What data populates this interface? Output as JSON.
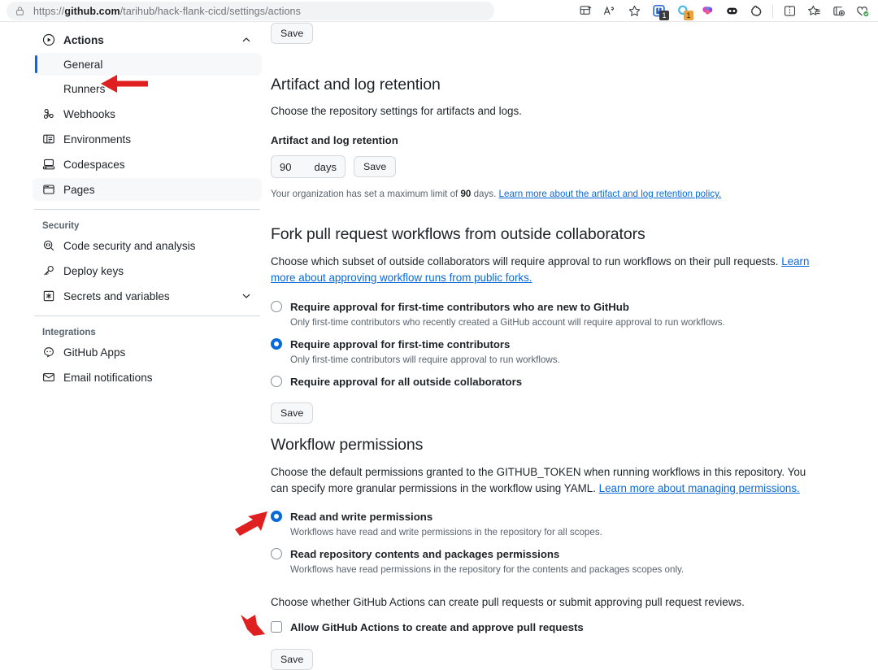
{
  "browser": {
    "url_prefix": "https://",
    "url_domain": "github.com",
    "url_path": "/tarihub/hack-flank-cicd/settings/actions",
    "url_full": "https://github.com/tarihub/hack-flank-cicd/settings/actions",
    "toolbar_icons": [
      {
        "name": "collections-icon",
        "badge": ""
      },
      {
        "name": "read-aloud-icon",
        "badge": ""
      },
      {
        "name": "favorite-star-icon",
        "badge": ""
      },
      {
        "name": "extension-blue-icon",
        "badge": "1"
      },
      {
        "name": "extension-cyan-icon",
        "badge": "1"
      },
      {
        "name": "extension-brain-icon",
        "badge": ""
      },
      {
        "name": "extension-dark-icon",
        "badge": ""
      },
      {
        "name": "extension-puzzle-icon",
        "badge": ""
      },
      {
        "name": "split-screen-icon",
        "badge": ""
      },
      {
        "name": "favorites-list-icon",
        "badge": ""
      },
      {
        "name": "collections-add-icon",
        "badge": ""
      },
      {
        "name": "browser-essentials-icon",
        "badge": ""
      }
    ]
  },
  "sidebar": {
    "actions": {
      "label": "Actions",
      "icon": "play-circle-icon",
      "chevron": "chevron-up-icon"
    },
    "actions_sub": [
      {
        "label": "General",
        "active": true
      },
      {
        "label": "Runners",
        "active": false
      }
    ],
    "items": [
      {
        "label": "Webhooks",
        "icon": "webhook-icon"
      },
      {
        "label": "Environments",
        "icon": "server-icon"
      },
      {
        "label": "Codespaces",
        "icon": "codespaces-icon"
      },
      {
        "label": "Pages",
        "icon": "browser-icon",
        "selected": true
      }
    ],
    "security_group": "Security",
    "security_items": [
      {
        "label": "Code security and analysis",
        "icon": "codescan-icon"
      },
      {
        "label": "Deploy keys",
        "icon": "key-icon"
      },
      {
        "label": "Secrets and variables",
        "icon": "asterisk-icon",
        "chevron": "chevron-down-icon"
      }
    ],
    "integrations_group": "Integrations",
    "integrations_items": [
      {
        "label": "GitHub Apps",
        "icon": "apps-icon"
      },
      {
        "label": "Email notifications",
        "icon": "mail-icon"
      }
    ]
  },
  "main": {
    "top_save_label": "Save",
    "artifact": {
      "title": "Artifact and log retention",
      "description": "Choose the repository settings for artifacts and logs.",
      "field_label": "Artifact and log retention",
      "value": "90",
      "unit": "days",
      "save_label": "Save",
      "note_prefix": "Your organization has set a maximum limit of ",
      "note_bold": "90",
      "note_suffix": " days. ",
      "note_link": "Learn more about the artifact and log retention policy."
    },
    "fork": {
      "title": "Fork pull request workflows from outside collaborators",
      "description": "Choose which subset of outside collaborators will require approval to run workflows on their pull requests. ",
      "description_link": "Learn more about approving workflow runs from public forks.",
      "options": [
        {
          "label": "Require approval for first-time contributors who are new to GitHub",
          "desc": "Only first-time contributors who recently created a GitHub account will require approval to run workflows.",
          "selected": false
        },
        {
          "label": "Require approval for first-time contributors",
          "desc": "Only first-time contributors will require approval to run workflows.",
          "selected": true
        },
        {
          "label": "Require approval for all outside collaborators",
          "desc": "",
          "selected": false
        }
      ],
      "save_label": "Save"
    },
    "permissions": {
      "title": "Workflow permissions",
      "description": "Choose the default permissions granted to the GITHUB_TOKEN when running workflows in this repository. You can specify more granular permissions in the workflow using YAML. ",
      "description_link": "Learn more about managing permissions.",
      "options": [
        {
          "label": "Read and write permissions",
          "desc": "Workflows have read and write permissions in the repository for all scopes.",
          "selected": true
        },
        {
          "label": "Read repository contents and packages permissions",
          "desc": "Workflows have read permissions in the repository for the contents and packages scopes only.",
          "selected": false
        }
      ],
      "pr_description": "Choose whether GitHub Actions can create pull requests or submit approving pull request reviews.",
      "pr_checkbox_label": "Allow GitHub Actions to create and approve pull requests",
      "pr_checkbox_checked": false,
      "save_label": "Save"
    }
  },
  "annotations": {
    "color": "#e02020",
    "arrows": [
      {
        "name": "arrow-pointing-to-general",
        "direction": "left"
      },
      {
        "name": "arrow-pointing-to-read-and-write-permissions",
        "direction": "up-right"
      },
      {
        "name": "arrow-pointing-to-save-button",
        "direction": "down-right"
      }
    ]
  },
  "colors": {
    "accent_blue": "#0969da",
    "annotation_red": "#e02020",
    "selected_bg": "#f6f8fa",
    "muted_text": "#59636e"
  }
}
